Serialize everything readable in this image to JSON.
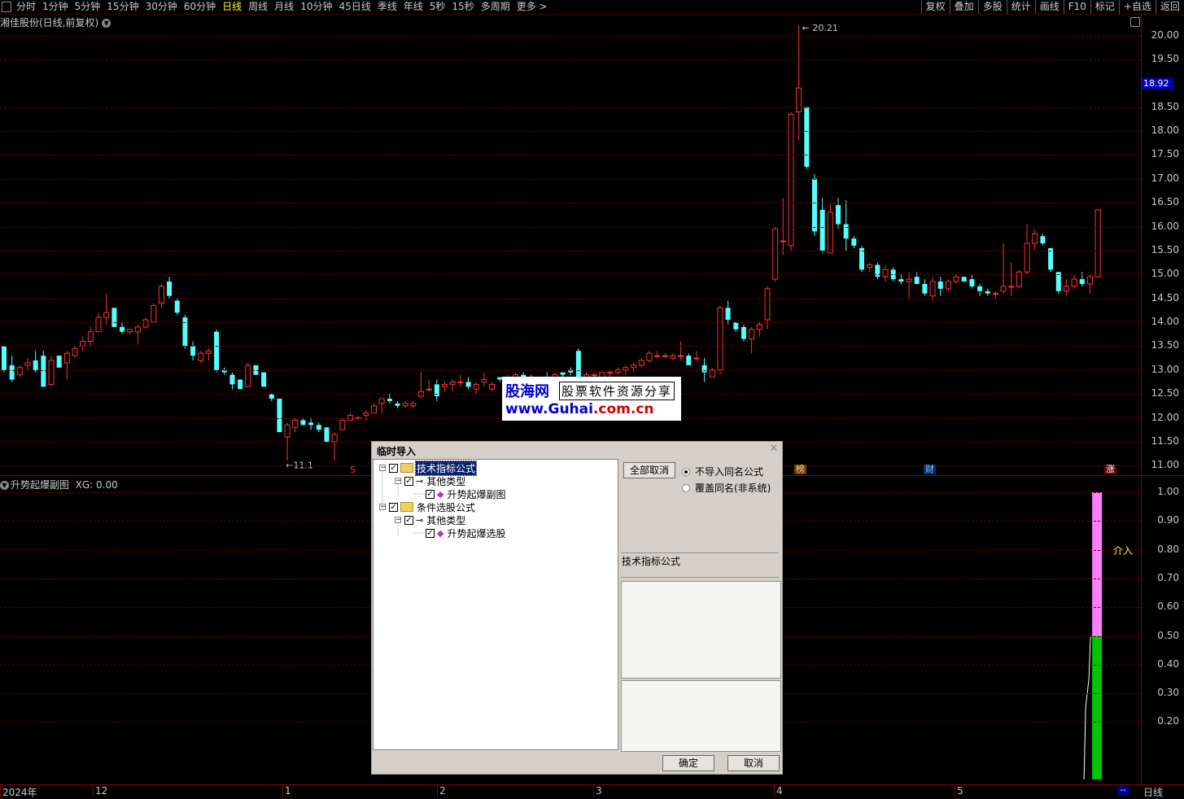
{
  "periods": [
    "分时",
    "1分钟",
    "5分钟",
    "15分钟",
    "30分钟",
    "60分钟",
    "日线",
    "周线",
    "月线",
    "10分钟",
    "45日线",
    "季线",
    "年线",
    "5秒",
    "15秒",
    "多周期",
    "更多 >"
  ],
  "active_period": "日线",
  "tools": [
    "复权",
    "叠加",
    "多股",
    "统计",
    "画线",
    "F10",
    "标记",
    "+自选",
    "返回"
  ],
  "stock_title": "湘佳股份(日线,前复权)",
  "price_axis": [
    "20.00",
    "19.50",
    "18.92",
    "18.50",
    "18.00",
    "17.50",
    "17.00",
    "16.50",
    "16.00",
    "15.50",
    "15.00",
    "14.50",
    "14.00",
    "13.50",
    "13.00",
    "12.50",
    "12.00",
    "11.50",
    "11.00"
  ],
  "current_price": "18.92",
  "high_label": "20.21",
  "low_label": "11.1",
  "markers": {
    "s": "S",
    "bang": "榜",
    "cai": "财",
    "zhang": "涨"
  },
  "indicator": {
    "title": "升势起爆副图",
    "xg_label": "XG: 0.00",
    "axis": [
      "1.00",
      "0.90",
      "0.80",
      "0.70",
      "0.60",
      "0.50",
      "0.40",
      "0.30",
      "0.20"
    ],
    "signal_label": "介入"
  },
  "date_axis": {
    "labels": [
      "2024年",
      "12",
      "1",
      "2",
      "3",
      "4",
      "5"
    ],
    "period": "日线",
    "mini": "--"
  },
  "watermark": {
    "brand": "股海网",
    "slogan": "股票软件资源分享",
    "url_prefix": "www.",
    "url_main": "Guhai",
    "url_suffix": ".com.cn"
  },
  "dialog": {
    "title": "临时导入",
    "tree": [
      {
        "label": "技术指标公式",
        "selected": true
      },
      {
        "label": "其他类型"
      },
      {
        "label": "升势起爆副图"
      },
      {
        "label": "条件选股公式"
      },
      {
        "label": "其他类型"
      },
      {
        "label": "升势起爆选股"
      }
    ],
    "cancel_all": "全部取消",
    "radio_skip": "不导入同名公式",
    "radio_overwrite": "覆盖同名(非系统)",
    "info_label": "技术指标公式",
    "ok": "确定",
    "cancel": "取消"
  },
  "colors": {
    "up": "#ff3232",
    "down": "#54ffff",
    "grid": "#6a0000",
    "pink": "#ff80ff",
    "green": "#00c800"
  },
  "chart_data": {
    "type": "candlestick",
    "ylim": [
      10.8,
      20.4
    ],
    "candles": [
      [
        13.5,
        13.5,
        12.95,
        13.0
      ],
      [
        13.1,
        13.3,
        12.75,
        12.8
      ],
      [
        12.9,
        13.1,
        12.85,
        13.05
      ],
      [
        13.1,
        13.25,
        13.0,
        13.15
      ],
      [
        13.2,
        13.4,
        12.95,
        13.0
      ],
      [
        13.3,
        13.4,
        12.65,
        12.65
      ],
      [
        12.7,
        13.3,
        12.65,
        13.2
      ],
      [
        13.3,
        13.3,
        13.05,
        13.05
      ],
      [
        13.15,
        13.4,
        12.8,
        13.35
      ],
      [
        13.3,
        13.5,
        13.25,
        13.45
      ],
      [
        13.5,
        13.7,
        13.4,
        13.6
      ],
      [
        13.6,
        13.9,
        13.5,
        13.8
      ],
      [
        13.8,
        14.2,
        13.8,
        14.1
      ],
      [
        14.1,
        14.6,
        13.95,
        14.2
      ],
      [
        14.3,
        14.3,
        13.9,
        13.9
      ],
      [
        13.9,
        14.0,
        13.75,
        13.8
      ],
      [
        13.8,
        13.85,
        13.75,
        13.85
      ],
      [
        13.8,
        13.95,
        13.55,
        13.9
      ],
      [
        13.9,
        14.1,
        13.85,
        14.05
      ],
      [
        14.0,
        14.4,
        14.0,
        14.35
      ],
      [
        14.4,
        14.8,
        14.3,
        14.75
      ],
      [
        14.85,
        14.95,
        14.5,
        14.55
      ],
      [
        14.45,
        14.5,
        14.15,
        14.2
      ],
      [
        14.1,
        14.15,
        13.45,
        13.5
      ],
      [
        13.5,
        13.6,
        13.2,
        13.3
      ],
      [
        13.2,
        13.4,
        13.15,
        13.35
      ],
      [
        13.35,
        13.45,
        13.2,
        13.4
      ],
      [
        13.8,
        13.85,
        12.95,
        13.0
      ],
      [
        13.0,
        13.05,
        12.9,
        12.95
      ],
      [
        12.9,
        12.95,
        12.6,
        12.7
      ],
      [
        12.8,
        12.8,
        12.6,
        12.6
      ],
      [
        12.65,
        13.15,
        12.65,
        13.1
      ],
      [
        13.1,
        13.1,
        12.9,
        12.9
      ],
      [
        12.95,
        12.95,
        12.65,
        12.65
      ],
      [
        12.5,
        12.5,
        12.35,
        12.4
      ],
      [
        12.4,
        12.4,
        11.7,
        11.7
      ],
      [
        11.6,
        11.9,
        11.1,
        11.85
      ],
      [
        11.8,
        12.0,
        11.7,
        11.95
      ],
      [
        11.95,
        12.0,
        11.85,
        11.85
      ],
      [
        11.9,
        12.0,
        11.75,
        11.85
      ],
      [
        11.85,
        11.9,
        11.7,
        11.75
      ],
      [
        11.8,
        11.8,
        11.5,
        11.5
      ],
      [
        11.5,
        11.7,
        11.1,
        11.65
      ],
      [
        11.75,
        12.0,
        11.75,
        11.95
      ],
      [
        11.95,
        12.1,
        11.95,
        12.05
      ],
      [
        12.0,
        12.05,
        12.0,
        12.0
      ],
      [
        12.05,
        12.15,
        11.95,
        12.1
      ],
      [
        12.1,
        12.3,
        12.1,
        12.25
      ],
      [
        12.3,
        12.4,
        12.1,
        12.4
      ],
      [
        12.4,
        12.5,
        12.3,
        12.35
      ],
      [
        12.3,
        12.35,
        12.2,
        12.25
      ],
      [
        12.25,
        12.35,
        12.2,
        12.3
      ],
      [
        12.25,
        12.35,
        12.2,
        12.3
      ],
      [
        12.45,
        12.95,
        12.4,
        12.55
      ],
      [
        12.6,
        12.8,
        12.55,
        12.6
      ],
      [
        12.7,
        12.8,
        12.35,
        12.45
      ],
      [
        12.65,
        12.75,
        12.55,
        12.7
      ],
      [
        12.7,
        12.8,
        12.55,
        12.75
      ],
      [
        12.75,
        12.9,
        12.65,
        12.75
      ],
      [
        12.75,
        12.85,
        12.6,
        12.65
      ],
      [
        12.6,
        12.75,
        12.5,
        12.7
      ],
      [
        12.75,
        12.95,
        12.65,
        12.8
      ],
      [
        12.6,
        12.75,
        12.55,
        12.7
      ],
      [
        12.85,
        12.85,
        12.75,
        12.8
      ],
      [
        12.8,
        12.9,
        12.7,
        12.85
      ],
      [
        12.85,
        12.95,
        12.8,
        12.9
      ],
      [
        12.9,
        12.95,
        12.8,
        12.85
      ],
      [
        12.85,
        12.9,
        12.75,
        12.8
      ],
      [
        12.8,
        12.85,
        12.7,
        12.85
      ],
      [
        12.85,
        12.95,
        12.75,
        12.8
      ],
      [
        12.85,
        12.95,
        12.75,
        12.9
      ],
      [
        12.95,
        12.95,
        12.85,
        12.9
      ],
      [
        13.0,
        13.05,
        12.9,
        12.95
      ],
      [
        13.4,
        13.45,
        12.75,
        12.8
      ],
      [
        12.8,
        12.95,
        12.7,
        12.9
      ],
      [
        12.9,
        12.95,
        12.85,
        12.9
      ],
      [
        12.85,
        12.95,
        12.8,
        12.95
      ],
      [
        12.95,
        13.0,
        12.85,
        12.95
      ],
      [
        12.95,
        13.05,
        12.9,
        13.0
      ],
      [
        13.0,
        13.1,
        12.9,
        13.05
      ],
      [
        13.05,
        13.15,
        12.95,
        13.1
      ],
      [
        13.1,
        13.25,
        13.05,
        13.2
      ],
      [
        13.2,
        13.4,
        13.15,
        13.35
      ],
      [
        13.3,
        13.4,
        13.25,
        13.3
      ],
      [
        13.3,
        13.35,
        13.25,
        13.3
      ],
      [
        13.25,
        13.35,
        13.2,
        13.3
      ],
      [
        13.3,
        13.6,
        13.2,
        13.3
      ],
      [
        13.3,
        13.35,
        13.1,
        13.1
      ],
      [
        13.25,
        13.4,
        13.2,
        13.25
      ],
      [
        13.1,
        13.25,
        12.75,
        12.95
      ],
      [
        12.85,
        13.05,
        12.85,
        13.0
      ],
      [
        13.0,
        14.35,
        12.9,
        14.3
      ],
      [
        14.3,
        14.45,
        13.95,
        14.05
      ],
      [
        14.0,
        14.0,
        13.8,
        13.85
      ],
      [
        13.9,
        13.95,
        13.6,
        13.65
      ],
      [
        13.65,
        13.9,
        13.35,
        13.85
      ],
      [
        13.85,
        14.0,
        13.7,
        13.95
      ],
      [
        14.05,
        14.75,
        13.85,
        14.7
      ],
      [
        14.9,
        16.0,
        14.85,
        15.95
      ],
      [
        15.7,
        16.6,
        15.4,
        15.7
      ],
      [
        15.6,
        18.4,
        15.5,
        18.35
      ],
      [
        18.4,
        20.21,
        17.8,
        18.9
      ],
      [
        18.5,
        18.5,
        17.2,
        17.25
      ],
      [
        17.0,
        17.1,
        15.8,
        15.9
      ],
      [
        16.35,
        16.6,
        15.45,
        15.5
      ],
      [
        15.45,
        16.5,
        15.45,
        16.3
      ],
      [
        16.45,
        16.6,
        15.95,
        16.05
      ],
      [
        16.05,
        16.55,
        15.5,
        15.75
      ],
      [
        15.75,
        15.8,
        15.55,
        15.6
      ],
      [
        15.55,
        15.6,
        15.05,
        15.1
      ],
      [
        15.15,
        15.25,
        15.05,
        15.2
      ],
      [
        15.2,
        15.25,
        14.9,
        14.95
      ],
      [
        14.95,
        15.2,
        14.85,
        15.1
      ],
      [
        15.1,
        15.15,
        14.85,
        14.9
      ],
      [
        14.9,
        15.0,
        14.8,
        14.85
      ],
      [
        14.85,
        15.05,
        14.5,
        14.9
      ],
      [
        14.95,
        15.05,
        14.85,
        14.8
      ],
      [
        14.8,
        14.9,
        14.55,
        14.6
      ],
      [
        14.55,
        14.95,
        14.45,
        14.85
      ],
      [
        14.85,
        14.95,
        14.55,
        14.7
      ],
      [
        14.7,
        14.9,
        14.65,
        14.85
      ],
      [
        14.85,
        15.0,
        14.8,
        14.95
      ],
      [
        14.95,
        14.95,
        14.85,
        14.85
      ],
      [
        14.9,
        15.0,
        14.7,
        14.75
      ],
      [
        14.75,
        14.8,
        14.55,
        14.65
      ],
      [
        14.65,
        14.7,
        14.55,
        14.6
      ],
      [
        14.6,
        14.65,
        14.5,
        14.6
      ],
      [
        14.65,
        15.65,
        14.6,
        14.75
      ],
      [
        14.75,
        15.25,
        14.55,
        14.75
      ],
      [
        14.75,
        15.1,
        14.7,
        15.05
      ],
      [
        15.05,
        16.05,
        15.0,
        15.65
      ],
      [
        15.65,
        15.95,
        15.5,
        15.85
      ],
      [
        15.8,
        15.85,
        15.6,
        15.65
      ],
      [
        15.55,
        15.55,
        15.05,
        15.1
      ],
      [
        15.05,
        15.05,
        14.6,
        14.65
      ],
      [
        14.65,
        14.9,
        14.55,
        14.75
      ],
      [
        14.75,
        15.0,
        14.7,
        14.9
      ],
      [
        14.9,
        15.05,
        14.75,
        14.8
      ],
      [
        14.8,
        15.0,
        14.6,
        14.95
      ],
      [
        14.95,
        16.35,
        14.95,
        16.35
      ]
    ],
    "indicator_bars": {
      "pink_from": 0.5,
      "pink_to": 1.0,
      "green_from": 0.0,
      "green_to": 0.5
    }
  }
}
